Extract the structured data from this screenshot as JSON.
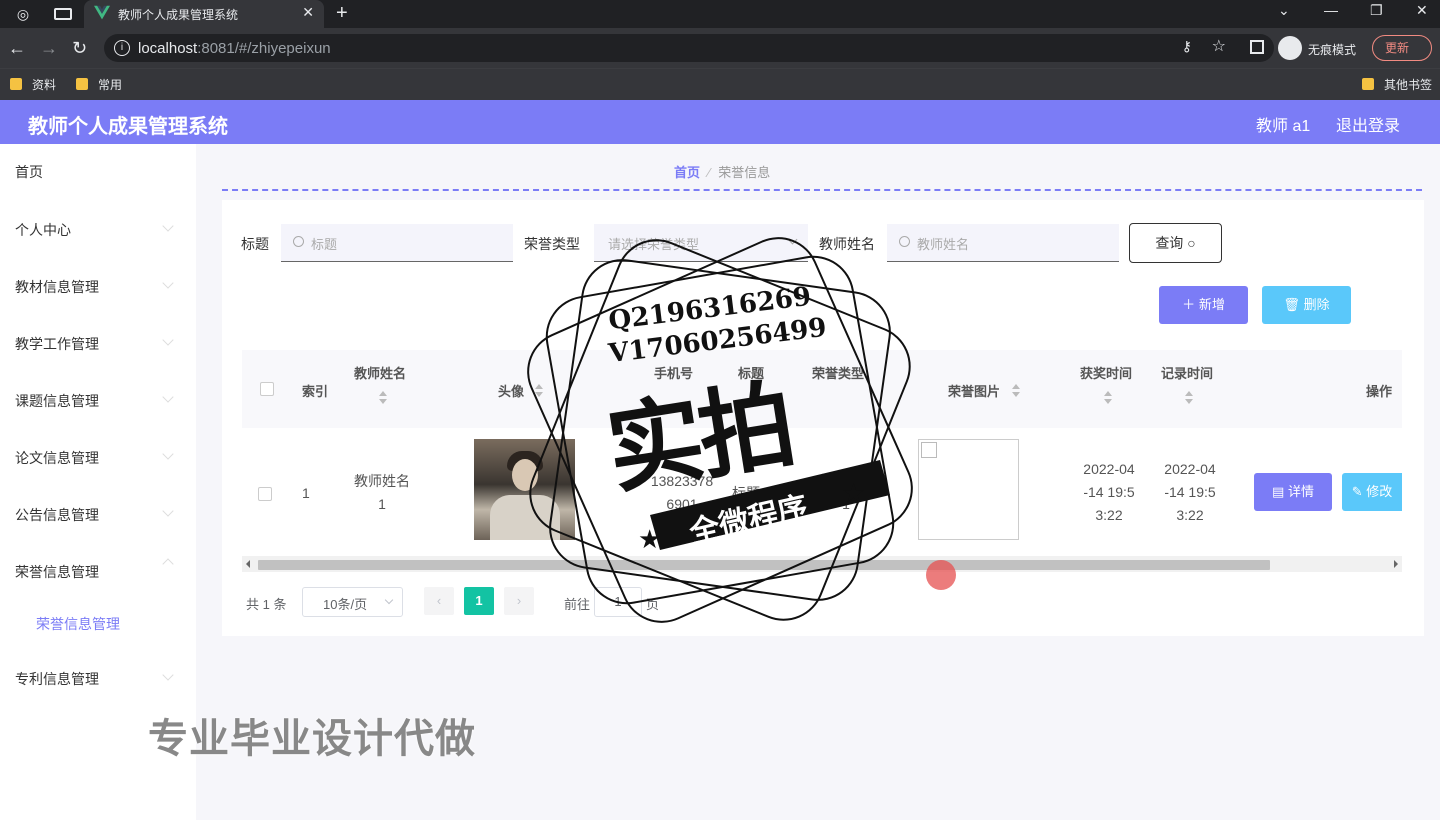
{
  "browser": {
    "tab_title": "教师个人成果管理系统",
    "url_host": "localhost",
    "url_rest": ":8081/#/zhiyepeixun",
    "incognito_label": "无痕模式",
    "update_label": "更新",
    "bookmarks": [
      "资料",
      "常用"
    ],
    "other_bookmarks": "其他书签"
  },
  "app": {
    "title": "教师个人成果管理系统",
    "user": "教师 a1",
    "logout": "退出登录",
    "accent": "#7b7cf6"
  },
  "sidebar": {
    "items": [
      {
        "label": "首页"
      },
      {
        "label": "个人中心"
      },
      {
        "label": "教材信息管理"
      },
      {
        "label": "教学工作管理"
      },
      {
        "label": "课题信息管理"
      },
      {
        "label": "论文信息管理"
      },
      {
        "label": "公告信息管理"
      },
      {
        "label": "荣誉信息管理"
      },
      {
        "label": "专利信息管理"
      }
    ],
    "sub_item": "荣誉信息管理"
  },
  "breadcrumb": {
    "home": "首页",
    "current": "荣誉信息"
  },
  "search": {
    "title_label": "标题",
    "title_placeholder": "标题",
    "type_label": "荣誉类型",
    "type_placeholder": "请选择荣誉类型",
    "teacher_label": "教师姓名",
    "teacher_placeholder": "教师姓名",
    "query_button": "查询"
  },
  "actions": {
    "add": "新增",
    "delete": "删除"
  },
  "table": {
    "headers": {
      "index": "索引",
      "teacher_name": "教师姓名",
      "avatar": "头像",
      "phone": "手机号",
      "title": "标题",
      "honor_type": "荣誉类型",
      "honor_image": "荣誉图片",
      "award_time": "获奖时间",
      "record_time": "记录时间",
      "operation": "操作"
    },
    "rows": [
      {
        "index": "1",
        "teacher_name_1": "教师姓名",
        "teacher_name_2": "1",
        "phone_1": "13823378",
        "phone_2": "6901",
        "title": "标题1",
        "honor_type_1": "荣誉类型",
        "honor_type_2": "1",
        "award_time_1": "2022-04",
        "award_time_2": "-14 19:5",
        "award_time_3": "3:22",
        "record_time_1": "2022-04",
        "record_time_2": "-14 19:5",
        "record_time_3": "3:22",
        "detail_button": "详情",
        "edit_button": "修改"
      }
    ]
  },
  "pagination": {
    "total": "共 1 条",
    "page_size": "10条/页",
    "current_page": "1",
    "goto_prefix": "前往",
    "goto_value": "1",
    "goto_suffix": "页"
  },
  "watermark": {
    "line1": "Q2196316269",
    "line2": "V17060256499",
    "big": "实拍",
    "banner": "全微程序",
    "bottom_text": "专业毕业设计代做"
  }
}
